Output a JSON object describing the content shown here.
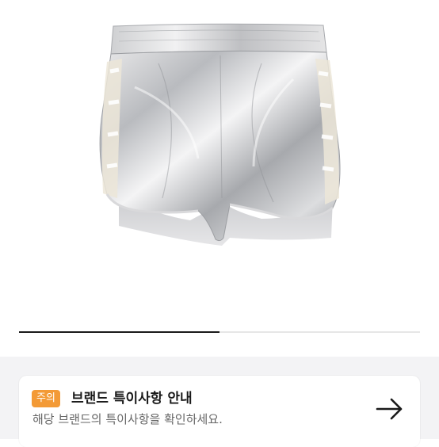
{
  "product": {
    "image_icon": "metallic-silver-shorts-photo"
  },
  "carousel": {
    "progress_fraction": 0.5
  },
  "notice": {
    "badge": "주의",
    "title": "브랜드 특이사항 안내",
    "description": "해당 브랜드의 특이사항을 확인하세요.",
    "arrow_icon": "arrow-right-icon",
    "badge_color": "#f39a36"
  }
}
